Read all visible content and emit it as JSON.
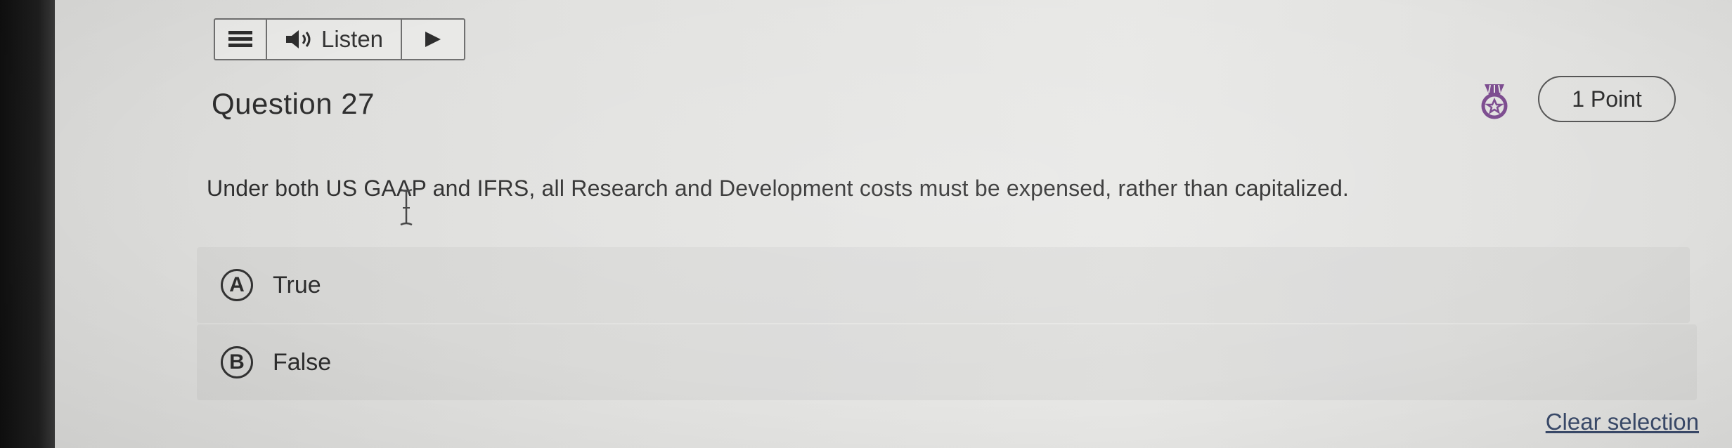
{
  "toolbar": {
    "menu_icon": "hamburger-menu-icon",
    "speaker_icon": "speaker-icon",
    "listen_label": "Listen",
    "play_icon": "play-icon"
  },
  "question": {
    "title": "Question 27",
    "points_label": "1 Point",
    "medal_icon": "medal-icon",
    "text": "Under both US GAAP and IFRS, all Research and Development costs must be expensed, rather than capitalized."
  },
  "options": [
    {
      "letter": "A",
      "label": "True"
    },
    {
      "letter": "B",
      "label": "False"
    }
  ],
  "clear_selection_label": "Clear selection",
  "colors": {
    "text": "#2d2d2d",
    "medal": "#7b4a8e",
    "link": "#3a4a6a"
  }
}
